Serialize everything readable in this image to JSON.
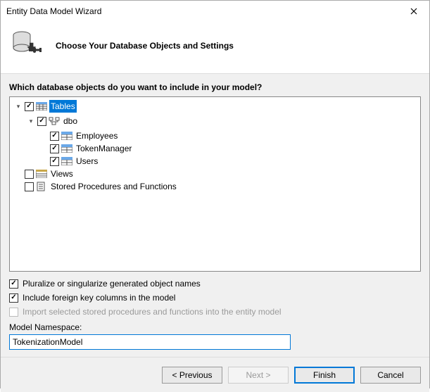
{
  "window": {
    "title": "Entity Data Model Wizard"
  },
  "header": {
    "heading": "Choose Your Database Objects and Settings"
  },
  "prompt": "Which database objects do you want to include in your model?",
  "tree": {
    "tables": {
      "label": "Tables",
      "dbo": {
        "label": "dbo",
        "items": [
          "Employees",
          "TokenManager",
          "Users"
        ]
      }
    },
    "views": {
      "label": "Views"
    },
    "sprocs": {
      "label": "Stored Procedures and Functions"
    }
  },
  "options": {
    "pluralize": "Pluralize or singularize generated object names",
    "fk": "Include foreign key columns in the model",
    "importSprocs": "Import selected stored procedures and functions into the entity model"
  },
  "namespace": {
    "label": "Model Namespace:",
    "value": "TokenizationModel"
  },
  "buttons": {
    "previous": "< Previous",
    "next": "Next >",
    "finish": "Finish",
    "cancel": "Cancel"
  }
}
